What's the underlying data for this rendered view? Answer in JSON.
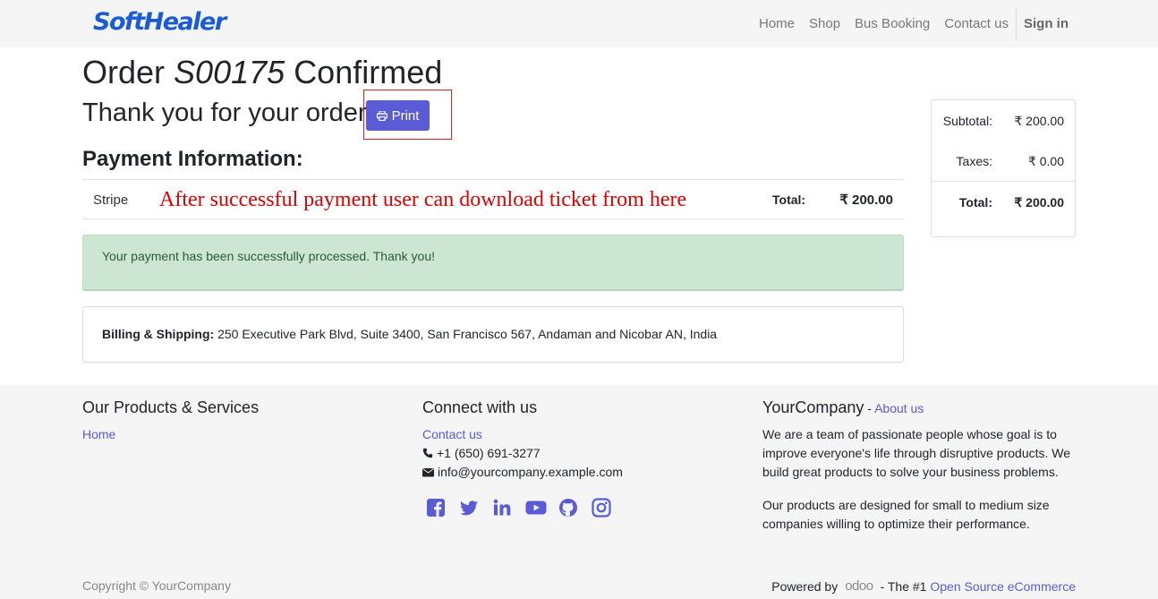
{
  "header": {
    "logo_text": "SoftHealer",
    "nav": [
      {
        "label": "Home"
      },
      {
        "label": "Shop"
      },
      {
        "label": "Bus Booking"
      },
      {
        "label": "Contact us"
      }
    ],
    "signin_label": "Sign in"
  },
  "order": {
    "title_prefix": "Order",
    "order_number": "S00175",
    "title_suffix": "Confirmed",
    "thank_you": "Thank you for your order.",
    "print_label": "Print"
  },
  "payment": {
    "heading": "Payment Information:",
    "method": "Stripe",
    "annotation": "After successful payment user can download ticket from here",
    "total_label": "Total:",
    "total_value": "₹ 200.00"
  },
  "alert": {
    "message": "Your payment has been successfully processed. Thank you!"
  },
  "billing": {
    "label": "Billing & Shipping:",
    "address": "250 Executive Park Blvd, Suite 3400, San Francisco 567, Andaman and Nicobar AN, India"
  },
  "summary": {
    "subtotal_label": "Subtotal:",
    "subtotal_value": "₹ 200.00",
    "taxes_label": "Taxes:",
    "taxes_value": "₹ 0.00",
    "total_label": "Total:",
    "total_value": "₹ 200.00"
  },
  "footer": {
    "col1": {
      "heading": "Our Products & Services",
      "link": "Home"
    },
    "col2": {
      "heading": "Connect with us",
      "link": "Contact us",
      "phone": "+1 (650) 691-3277",
      "email": "info@yourcompany.example.com",
      "social_icons": [
        "facebook-icon",
        "twitter-icon",
        "linkedin-icon",
        "youtube-icon",
        "github-icon",
        "instagram-icon"
      ]
    },
    "col3": {
      "company": "YourCompany",
      "dash": " - ",
      "about_link": "About us",
      "para1": "We are a team of passionate people whose goal is to improve everyone's life through disruptive products. We build great products to solve your business problems.",
      "para2": "Our products are designed for small to medium size companies willing to optimize their performance."
    },
    "copyright": "Copyright © YourCompany",
    "powered_by": "Powered by",
    "odoo_text": "odoo",
    "tagline": "- The #1",
    "ecommerce_link": "Open Source eCommerce"
  },
  "colors": {
    "accent": "#5b5bd6",
    "annotation_red": "#e00000",
    "alert_bg": "#cde6d4"
  }
}
